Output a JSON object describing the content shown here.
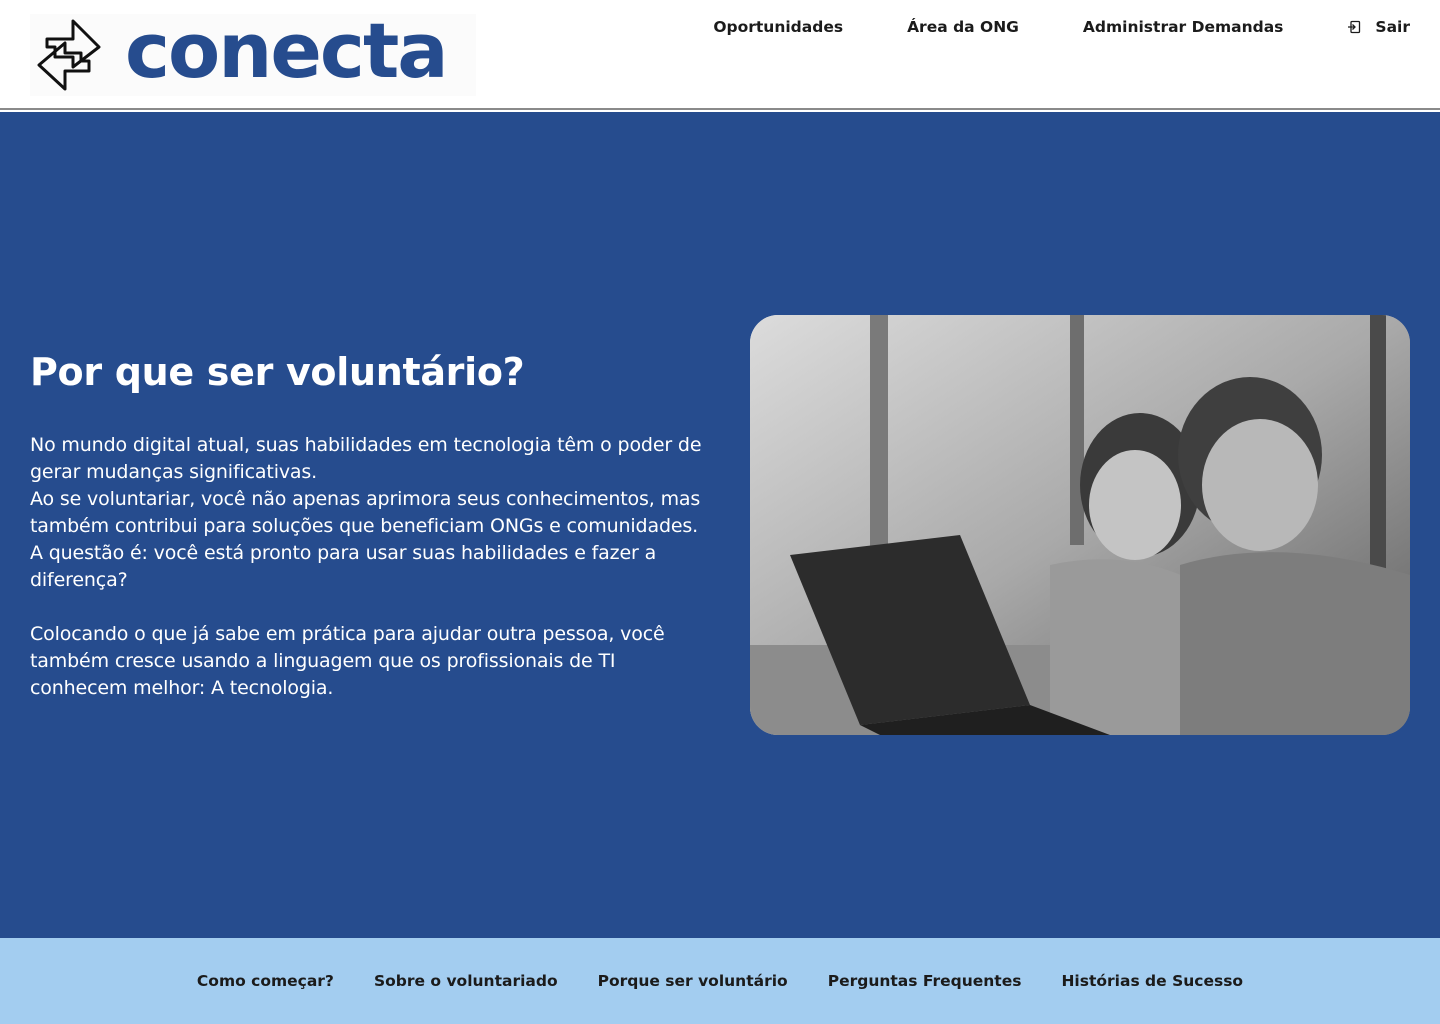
{
  "colors": {
    "brand": "#264c8e",
    "hero_bg": "#264c8e",
    "footer_bg": "#a3cdf0",
    "text_dark": "#1b1b1b",
    "text_light": "#ffffff"
  },
  "header": {
    "logo_text": "conecta",
    "logo_icon": "arrows-exchange-icon",
    "nav": [
      {
        "label": "Oportunidades"
      },
      {
        "label": "Área da ONG"
      },
      {
        "label": "Administrar Demandas"
      },
      {
        "label": "Sair",
        "icon": "logout-icon"
      }
    ]
  },
  "hero": {
    "title": "Por que ser voluntário?",
    "paragraph1_lines": [
      "No mundo digital atual, suas habilidades em tecnologia têm o poder de gerar mudanças significativas.",
      "Ao se voluntariar, você não apenas aprimora seus conhecimentos, mas também contribui para soluções que beneficiam ONGs e comunidades.",
      "A questão é: você está pronto para usar suas habilidades e fazer a diferença?"
    ],
    "paragraph2": "Colocando o que já sabe em prática para ajudar outra pessoa, você também cresce usando a linguagem que os profissionais de TI conhecem melhor: A tecnologia.",
    "image": "photo-volunteers-laptop"
  },
  "footer": {
    "links": [
      {
        "label": "Como começar?"
      },
      {
        "label": "Sobre o voluntariado"
      },
      {
        "label": "Porque ser voluntário"
      },
      {
        "label": "Perguntas Frequentes"
      },
      {
        "label": "Histórias de Sucesso"
      }
    ]
  }
}
